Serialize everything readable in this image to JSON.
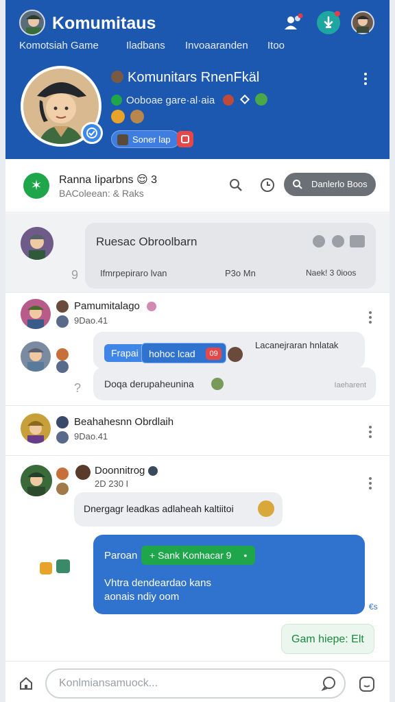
{
  "header": {
    "app_title": "Komumitaus",
    "tabs": [
      "Komotsiah Game",
      "Iladbans",
      "Invoaaranden",
      "Itoo"
    ],
    "profile": {
      "name": "Komunitars RnenFkäl",
      "meta": "Ooboae gare·al·aia",
      "button_label": "Soner lap"
    }
  },
  "filterbar": {
    "title": "Ranna Iiparbns",
    "title_emoji": "😌",
    "title_count": "3",
    "subtitle": "BAColeean: & Raks",
    "search_label": "Danlerlo Boos"
  },
  "posts": [
    {
      "bubble_title": "Ruesac Obroolbarn",
      "footer_left": "Ifmrpepiraro lvan",
      "footer_mid": "P3o Mn",
      "footer_right": "Naek! 3 0ioos",
      "badge": "9"
    },
    {
      "name": "Pamumitalago",
      "time": "9Dao.41",
      "chip1": "Frapai",
      "chip2": "hohoc lcad",
      "chip_badge": "09",
      "reply_text": "Lacanejraran hnlatak",
      "bubble_text": "Doqa derupaheunina",
      "bubble_right": "Iaeharent",
      "badge": "?"
    },
    {
      "name": "Beahahesnn Obrdlaih",
      "time": "9Dao.41"
    },
    {
      "name": "Doonnitrog",
      "time": "2D 230 I",
      "message_text": "Dnergagr leadkas adlaheah kaltiitoi",
      "blue_title": "Paroan",
      "blue_chip": "+ Sank Konhacar 9",
      "blue_chip_more": "•",
      "blue_body_1": "Vhtra dendeardao kans",
      "blue_body_2": "aonais ndiy oom",
      "blue_stamp": "€s",
      "reply_button": "Gam hiepe: Elt"
    }
  ],
  "composer": {
    "placeholder": "Konlmiansamuock..."
  },
  "colors": {
    "header_blue": "#1c57b0",
    "accent_green": "#1fa64a",
    "bubble_blue": "#2f73cf",
    "bubble_grey": "#eceef1",
    "chip_red": "#e54848"
  }
}
